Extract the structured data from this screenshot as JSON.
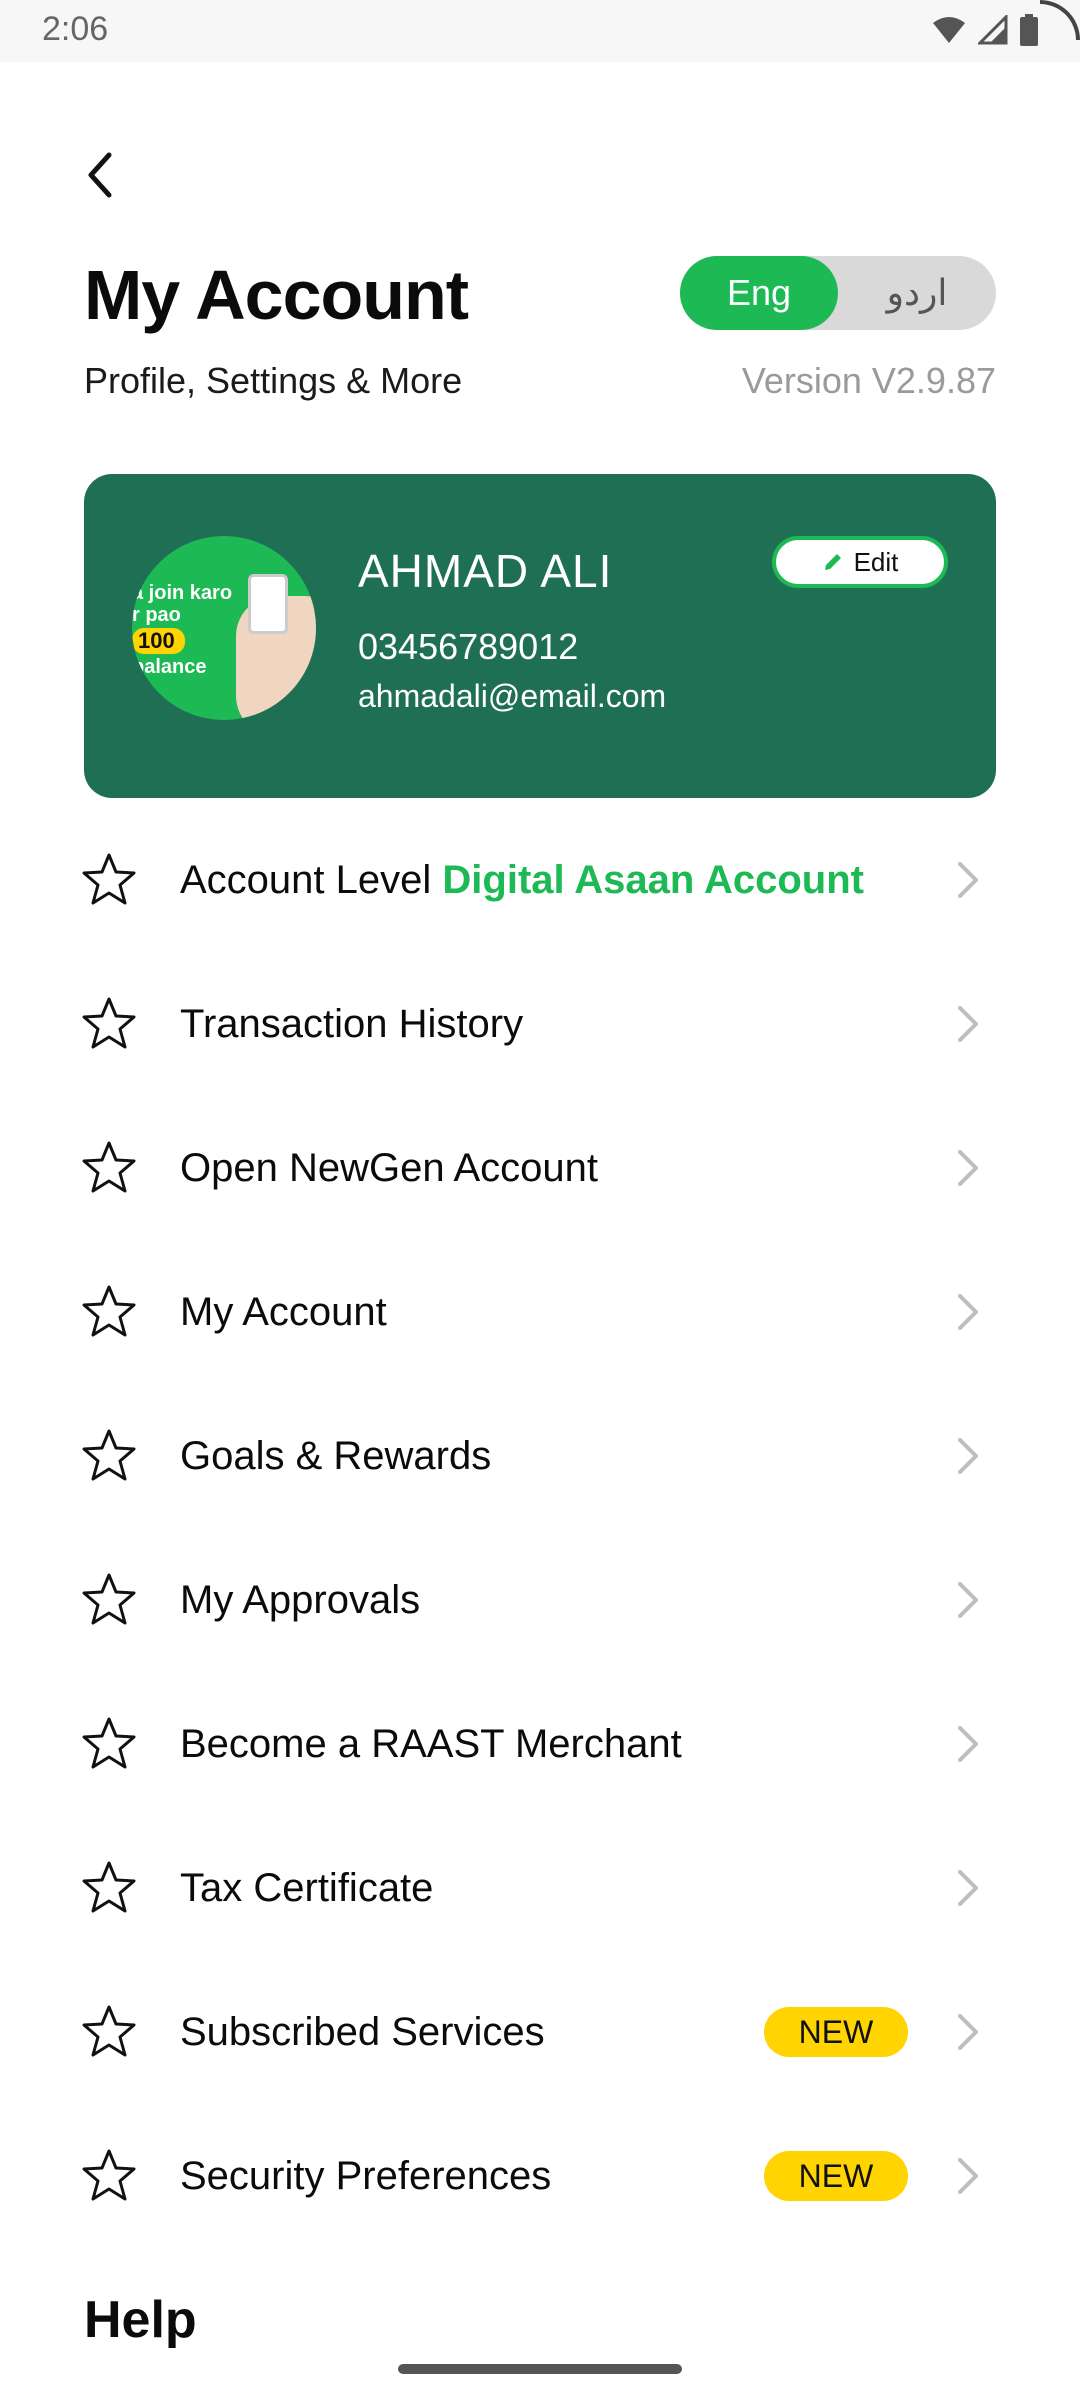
{
  "status_bar": {
    "time": "2:06"
  },
  "header": {
    "title": "My Account",
    "subtitle": "Profile, Settings & More",
    "version": "Version V2.9.87",
    "language": {
      "options": [
        "Eng",
        "اردو"
      ],
      "selected": "Eng"
    }
  },
  "profile": {
    "name": "AHMAD ALI",
    "phone": "03456789012",
    "email": "ahmadali@email.com",
    "edit_label": "Edit",
    "avatar_promo": {
      "line1": "a join karo",
      "line2": "r pao",
      "badge": "100",
      "line3": "balance"
    }
  },
  "menu": {
    "items": [
      {
        "label": "Account Level",
        "accent": "Digital Asaan Account",
        "badge": ""
      },
      {
        "label": "Transaction History",
        "accent": "",
        "badge": ""
      },
      {
        "label": "Open NewGen Account",
        "accent": "",
        "badge": ""
      },
      {
        "label": "My Account",
        "accent": "",
        "badge": ""
      },
      {
        "label": "Goals & Rewards",
        "accent": "",
        "badge": ""
      },
      {
        "label": "My Approvals",
        "accent": "",
        "badge": ""
      },
      {
        "label": "Become a RAAST Merchant",
        "accent": "",
        "badge": ""
      },
      {
        "label": "Tax Certificate",
        "accent": "",
        "badge": ""
      },
      {
        "label": "Subscribed Services",
        "accent": "",
        "badge": "NEW"
      },
      {
        "label": "Security Preferences",
        "accent": "",
        "badge": "NEW"
      }
    ]
  },
  "help": {
    "heading": "Help"
  },
  "colors": {
    "brand_green": "#1db954",
    "card_green": "#1e6f54",
    "badge_yellow": "#ffd400"
  }
}
